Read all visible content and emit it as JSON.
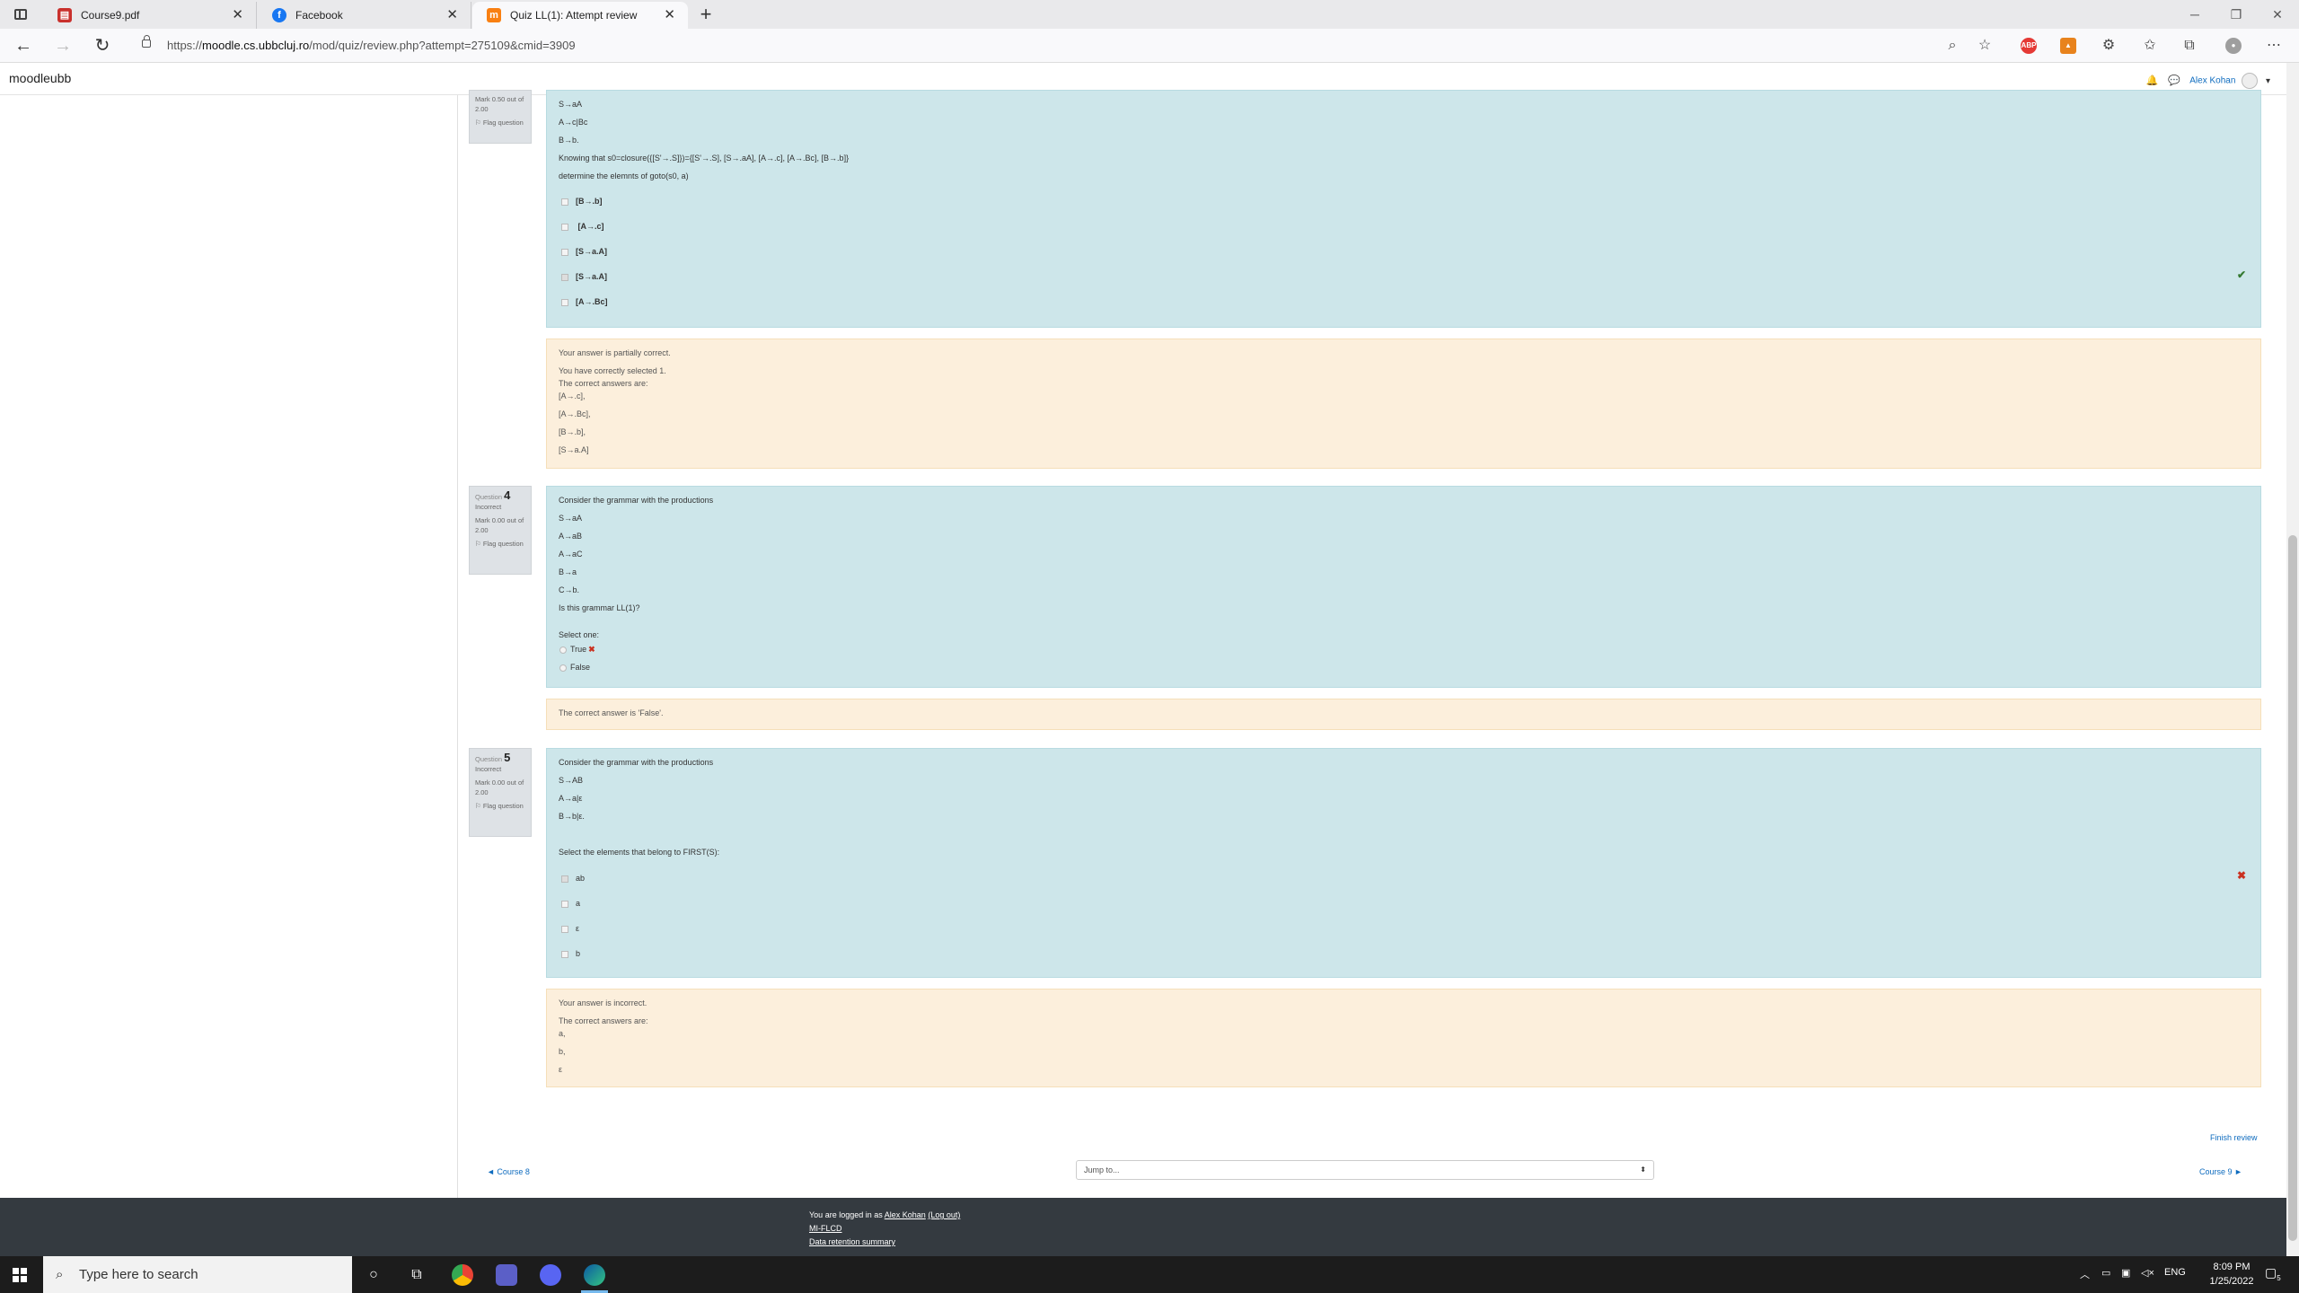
{
  "browser": {
    "tabs": [
      {
        "title": "Course9.pdf",
        "icon": "pdf-icon"
      },
      {
        "title": "Facebook",
        "icon": "facebook-icon"
      },
      {
        "title": "Quiz LL(1): Attempt review",
        "icon": "moodle-icon"
      }
    ],
    "url_prefix": "https://",
    "url_host": "moodle.cs.ubbcluj.ro",
    "url_path": "/mod/quiz/review.php?attempt=275109&cmid=3909"
  },
  "moodle": {
    "brand": "moodleubb",
    "user": "Alex Kohan"
  },
  "q3": {
    "info": {
      "mark": "Mark 0.50 out of 2.00",
      "flag": "Flag question"
    },
    "lines": [
      "S→aA",
      "A→c|Bc",
      "B→b.",
      "Knowing that s0=closure({[S'→.S]})={[S'→.S], [S→.aA], [A→.c], [A→.Bc], [B→.b]}",
      "determine the elemnts of goto(s0, a)"
    ],
    "options": [
      "[B→.b]",
      " [A→.c]",
      "[S→a.A]",
      "[S→a.A]",
      "[A→.Bc]"
    ],
    "feedback": [
      "Your answer is partially correct.",
      "You have correctly selected 1.",
      "The correct answers are:",
      " [A→.c],",
      "[A→.Bc],",
      "[B→.b],",
      "[S→a.A]"
    ]
  },
  "q4": {
    "info": {
      "label": "Question",
      "number": "4",
      "status": "Incorrect",
      "mark": "Mark 0.00 out of 2.00",
      "flag": "Flag question"
    },
    "lines": [
      "Consider the grammar with the productions",
      "S→aA",
      "A→aB",
      "A→aC",
      "B→a",
      "C→b.",
      "Is this grammar LL(1)?"
    ],
    "select_one": "Select one:",
    "options": [
      "True",
      "False"
    ],
    "feedback": "The correct answer is 'False'."
  },
  "q5": {
    "info": {
      "label": "Question",
      "number": "5",
      "status": "Incorrect",
      "mark": "Mark 0.00 out of 2.00",
      "flag": "Flag question"
    },
    "lines": [
      "Consider the grammar with the productions",
      "S→AB",
      "A→a|ε",
      "B→b|ε."
    ],
    "prompt": "Select the elements that belong to FIRST(S):",
    "options": [
      "ab",
      "a",
      "ε",
      "b"
    ],
    "feedback": [
      "Your answer is incorrect.",
      "The correct answers are:",
      "a,",
      "b,",
      "ε"
    ]
  },
  "bottom": {
    "finish_review": "Finish review",
    "prev_link": "◄ Course 8",
    "next_link": "Course 9 ►",
    "jump_to": "Jump to..."
  },
  "footer": {
    "logged_in_prefix": "You are logged in as",
    "user": "Alex Kohan",
    "logout": "(Log out)",
    "course_code": "MI-FLCD",
    "data_retention": "Data retention summary"
  },
  "taskbar": {
    "search_placeholder": "Type here to search",
    "lang": "ENG",
    "time": "8:09 PM",
    "date": "1/25/2022",
    "notifications": "5"
  }
}
